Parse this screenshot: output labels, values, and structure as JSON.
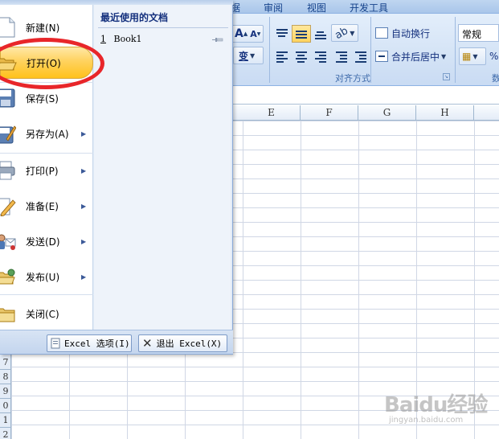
{
  "ribbon": {
    "tabs": [
      "据",
      "审阅",
      "视图",
      "开发工具"
    ],
    "alignment_group_label": "对齐方式",
    "partial_group_label": "数",
    "wrap_text_label": "自动换行",
    "merge_center_label": "合并后居中",
    "number_format_value": "常规",
    "percent_symbol": "%",
    "font_grow_glyph": "A",
    "font_shrink_glyph": "A",
    "phonetic_glyph": "变"
  },
  "columns": [
    "E",
    "F",
    "G",
    "H"
  ],
  "rows": [
    "7",
    "8",
    "9",
    "0",
    "1",
    "2"
  ],
  "office_menu": {
    "commands": [
      {
        "label": "新建(N)",
        "has_submenu": false,
        "icon": "new-document-icon"
      },
      {
        "label": "打开(O)",
        "has_submenu": false,
        "icon": "open-folder-icon"
      },
      {
        "label": "保存(S)",
        "has_submenu": false,
        "icon": "save-disk-icon"
      },
      {
        "label": "另存为(A)",
        "has_submenu": true,
        "icon": "save-as-icon"
      },
      {
        "label": "打印(P)",
        "has_submenu": true,
        "icon": "printer-icon"
      },
      {
        "label": "准备(E)",
        "has_submenu": true,
        "icon": "prepare-pencil-icon"
      },
      {
        "label": "发送(D)",
        "has_submenu": true,
        "icon": "send-icon"
      },
      {
        "label": "发布(U)",
        "has_submenu": true,
        "icon": "publish-folder-icon"
      },
      {
        "label": "关闭(C)",
        "has_submenu": false,
        "icon": "close-folder-icon"
      }
    ],
    "highlighted_command": "打开(O)",
    "submenu_arrow": "▶",
    "recent_title": "最近使用的文档",
    "recent_items": [
      {
        "index": "1",
        "name": "Book1"
      }
    ],
    "footer": {
      "options_label": "Excel 选项(I)",
      "exit_label": "退出 Excel(X)"
    }
  },
  "watermark": {
    "logo": "Baidu经验",
    "sub": "jingyan.baidu.com"
  },
  "colors": {
    "highlight_ring": "#e8262a",
    "active_item": "#ffd25e",
    "ribbon_bg": "#d5e4f6"
  }
}
